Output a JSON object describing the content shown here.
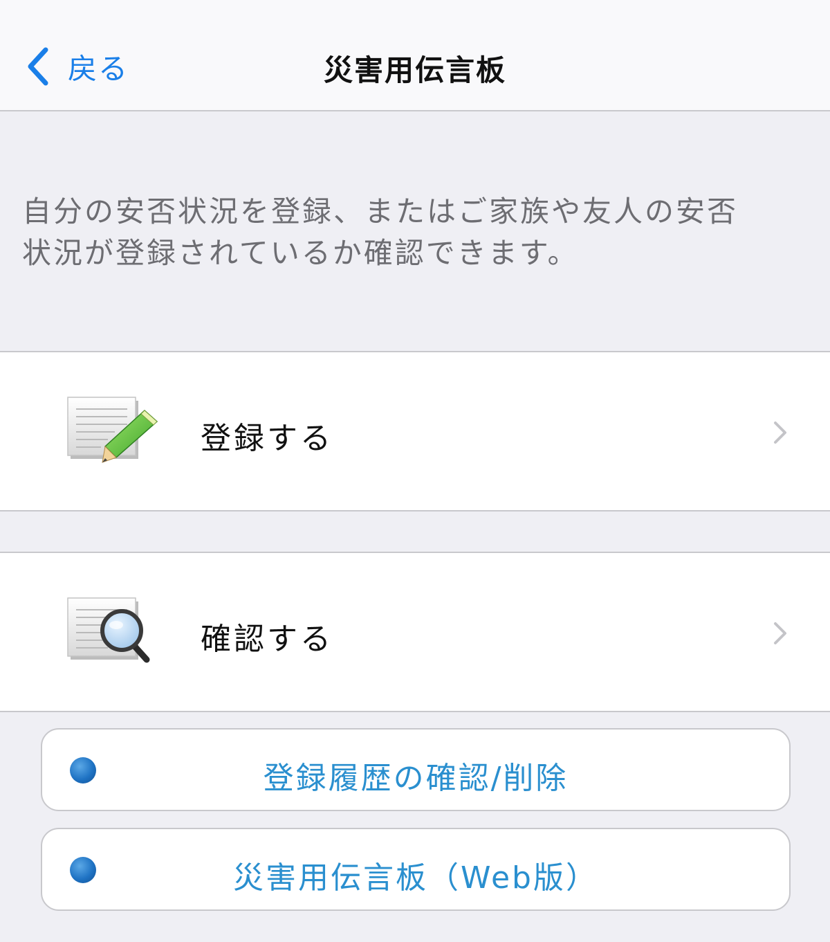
{
  "nav": {
    "back_label": "戻る",
    "title": "災害用伝言板"
  },
  "description": {
    "line1": "自分の安否状況を登録、またはご家族や友人の安否",
    "line2": "状況が登録されているか確認できます。"
  },
  "menu": {
    "register": {
      "label": "登録する",
      "icon": "notepad-pencil-icon"
    },
    "confirm": {
      "label": "確認する",
      "icon": "notepad-magnifier-icon"
    }
  },
  "links": {
    "history": {
      "label": "登録履歴の確認/削除",
      "icon": "globe-bullet-icon"
    },
    "web": {
      "label": "災害用伝言板（Web版）",
      "icon": "globe-bullet-icon"
    }
  },
  "colors": {
    "accent_blue": "#1a7fe8",
    "link_blue": "#2a8fcf",
    "background": "#efeff4"
  }
}
